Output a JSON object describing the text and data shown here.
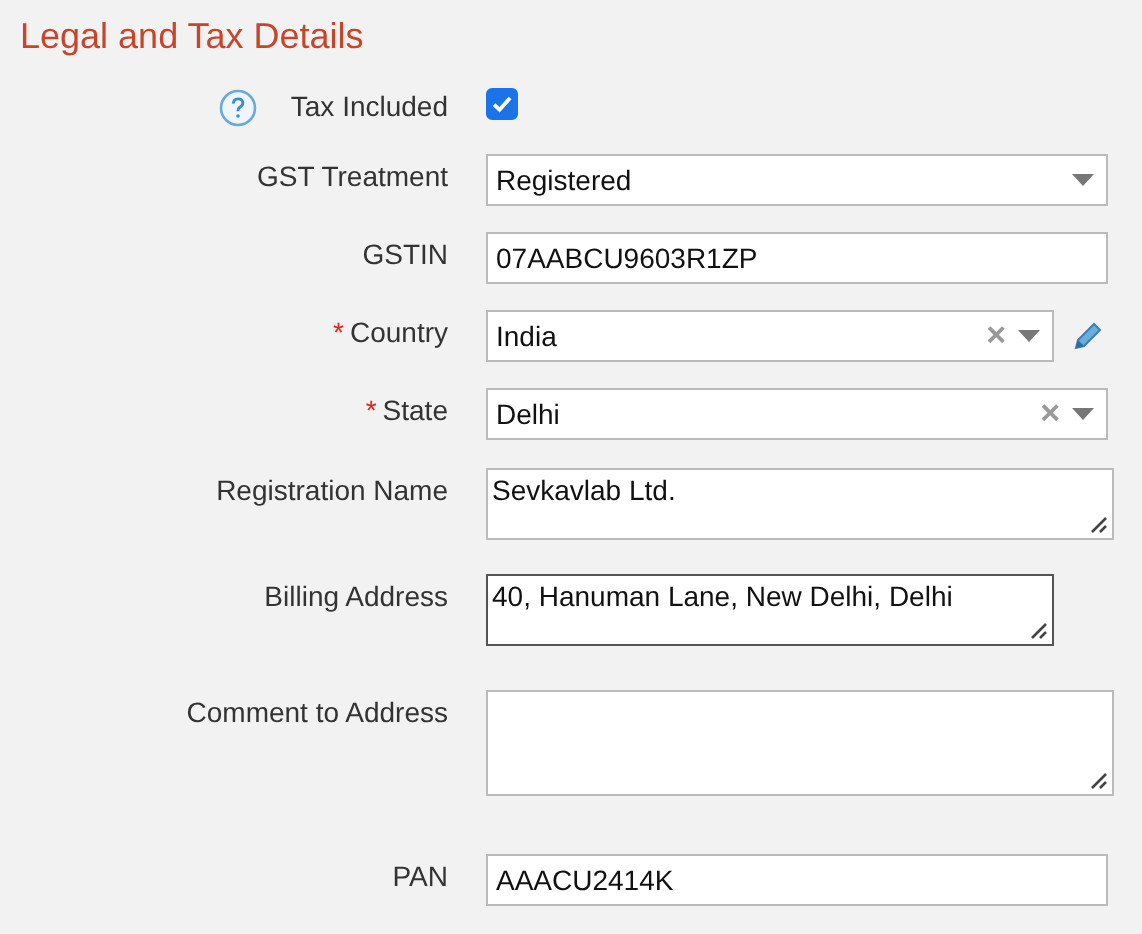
{
  "section": {
    "title": "Legal and Tax Details"
  },
  "fields": [
    {
      "kind": "checkbox",
      "label": "Tax Included",
      "help": true,
      "checked": true
    },
    {
      "kind": "select",
      "label": "GST Treatment",
      "value": "Registered"
    },
    {
      "kind": "text",
      "label": "GSTIN",
      "value": "07AABCU9603R1ZP"
    },
    {
      "kind": "combo",
      "label": "Country",
      "marker": "*",
      "value": "India",
      "clear": "×",
      "editable": true
    },
    {
      "kind": "combo",
      "label": "State",
      "marker": "*",
      "value": "Delhi",
      "clear": "×",
      "editable": false
    },
    {
      "kind": "textarea",
      "label": "Registration Name",
      "value": "Sevkavlab Ltd.",
      "focused": false
    },
    {
      "kind": "textarea",
      "label": "Billing Address",
      "value": "40, Hanuman Lane, New Delhi, Delhi",
      "focused": true
    },
    {
      "kind": "textarea",
      "label": "Comment to Address",
      "focused": false
    },
    {
      "kind": "text",
      "label": "PAN",
      "value": "AAACU2414K"
    }
  ]
}
